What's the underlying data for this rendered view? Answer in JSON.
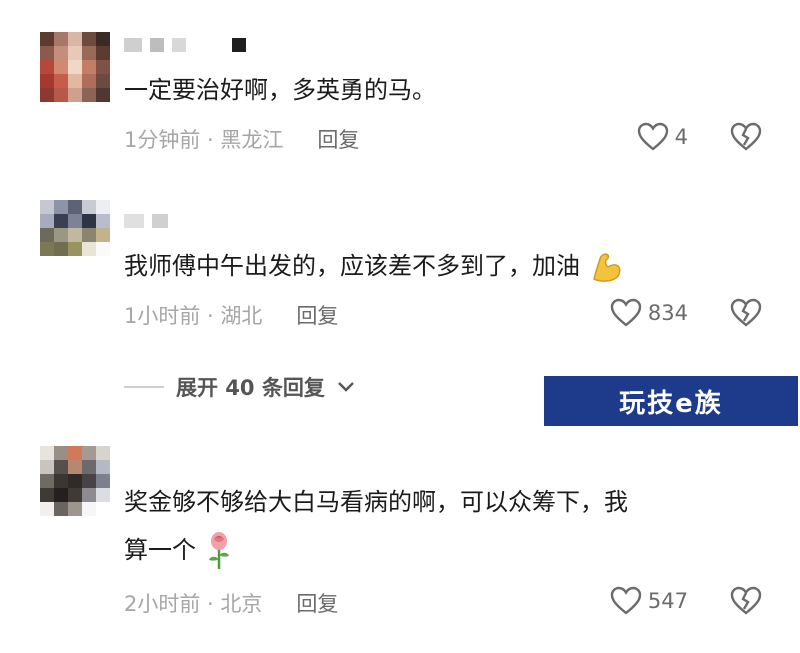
{
  "comments": [
    {
      "text": "一定要治好啊，多英勇的马。",
      "time_location": "1分钟前 · 黑龙江",
      "reply_label": "回复",
      "likes": "4"
    },
    {
      "text": "我师傅中午出发的，应该差不多到了，加油",
      "time_location": "1小时前 · 湖北",
      "reply_label": "回复",
      "likes": "834",
      "expand_label": "展开 40 条回复",
      "trailing_emoji": "flexed-biceps-emoji"
    },
    {
      "text_line1": "奖金够不够给大白马看病的啊，可以众筹下，我",
      "text_line2": "算一个",
      "time_location": "2小时前 · 北京",
      "reply_label": "回复",
      "likes": "547",
      "trailing_emoji": "rose-emoji"
    }
  ],
  "watermark": "玩技e族",
  "colors": {
    "text": "#1b1b1b",
    "meta": "#a6a6a6",
    "reply": "#6b6b6b",
    "watermark_bg": "#1e3a8a"
  },
  "icons": [
    "heart-outline-icon",
    "broken-heart-icon",
    "chevron-down-icon"
  ]
}
